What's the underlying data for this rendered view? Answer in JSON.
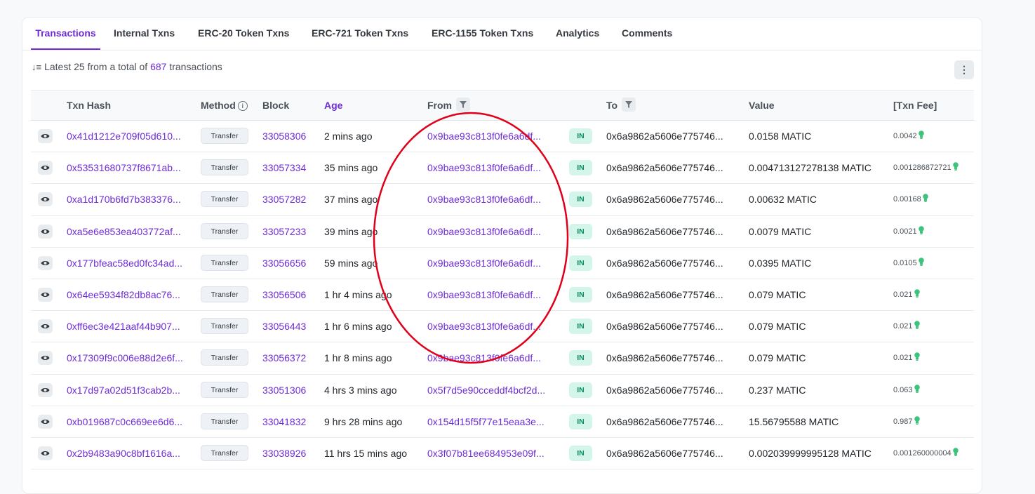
{
  "tabs": [
    {
      "label": "Transactions",
      "active": true
    },
    {
      "label": "Internal Txns",
      "active": false
    },
    {
      "label": "ERC-20 Token Txns",
      "active": false
    },
    {
      "label": "ERC-721 Token Txns",
      "active": false
    },
    {
      "label": "ERC-1155 Token Txns",
      "active": false
    },
    {
      "label": "Analytics",
      "active": false
    },
    {
      "label": "Comments",
      "active": false
    }
  ],
  "summary": {
    "prefix": "Latest 25 from a total of",
    "count": "687",
    "suffix": "transactions",
    "sort_icon": "sort-descending-icon"
  },
  "more_button": {
    "glyph": "⋮",
    "icon": "more-vertical-icon"
  },
  "columns": {
    "hash": "Txn Hash",
    "method": "Method",
    "block": "Block",
    "age": "Age",
    "from": "From",
    "to": "To",
    "value": "Value",
    "fee": "[Txn Fee]"
  },
  "rows": [
    {
      "hash": "0x41d1212e709f05d610...",
      "method": "Transfer",
      "block": "33058306",
      "age": "2 mins ago",
      "from": "0x9bae93c813f0fe6a6df...",
      "dir": "IN",
      "to": "0x6a9862a5606e775746...",
      "value": "0.0158 MATIC",
      "fee": "0.0042"
    },
    {
      "hash": "0x53531680737f8671ab...",
      "method": "Transfer",
      "block": "33057334",
      "age": "35 mins ago",
      "from": "0x9bae93c813f0fe6a6df...",
      "dir": "IN",
      "to": "0x6a9862a5606e775746...",
      "value": "0.004713127278138 MATIC",
      "fee": "0.001286872721"
    },
    {
      "hash": "0xa1d170b6fd7b383376...",
      "method": "Transfer",
      "block": "33057282",
      "age": "37 mins ago",
      "from": "0x9bae93c813f0fe6a6df...",
      "dir": "IN",
      "to": "0x6a9862a5606e775746...",
      "value": "0.00632 MATIC",
      "fee": "0.00168"
    },
    {
      "hash": "0xa5e6e853ea403772af...",
      "method": "Transfer",
      "block": "33057233",
      "age": "39 mins ago",
      "from": "0x9bae93c813f0fe6a6df...",
      "dir": "IN",
      "to": "0x6a9862a5606e775746...",
      "value": "0.0079 MATIC",
      "fee": "0.0021"
    },
    {
      "hash": "0x177bfeac58ed0fc34ad...",
      "method": "Transfer",
      "block": "33056656",
      "age": "59 mins ago",
      "from": "0x9bae93c813f0fe6a6df...",
      "dir": "IN",
      "to": "0x6a9862a5606e775746...",
      "value": "0.0395 MATIC",
      "fee": "0.0105"
    },
    {
      "hash": "0x64ee5934f82db8ac76...",
      "method": "Transfer",
      "block": "33056506",
      "age": "1 hr 4 mins ago",
      "from": "0x9bae93c813f0fe6a6df...",
      "dir": "IN",
      "to": "0x6a9862a5606e775746...",
      "value": "0.079 MATIC",
      "fee": "0.021"
    },
    {
      "hash": "0xff6ec3e421aaf44b907...",
      "method": "Transfer",
      "block": "33056443",
      "age": "1 hr 6 mins ago",
      "from": "0x9bae93c813f0fe6a6df...",
      "dir": "IN",
      "to": "0x6a9862a5606e775746...",
      "value": "0.079 MATIC",
      "fee": "0.021"
    },
    {
      "hash": "0x17309f9c006e88d2e6f...",
      "method": "Transfer",
      "block": "33056372",
      "age": "1 hr 8 mins ago",
      "from": "0x9bae93c813f0fe6a6df...",
      "dir": "IN",
      "to": "0x6a9862a5606e775746...",
      "value": "0.079 MATIC",
      "fee": "0.021"
    },
    {
      "hash": "0x17d97a02d51f3cab2b...",
      "method": "Transfer",
      "block": "33051306",
      "age": "4 hrs 3 mins ago",
      "from": "0x5f7d5e90cceddf4bcf2d...",
      "dir": "IN",
      "to": "0x6a9862a5606e775746...",
      "value": "0.237 MATIC",
      "fee": "0.063"
    },
    {
      "hash": "0xb019687c0c669ee6d6...",
      "method": "Transfer",
      "block": "33041832",
      "age": "9 hrs 28 mins ago",
      "from": "0x154d15f5f77e15eaa3e...",
      "dir": "IN",
      "to": "0x6a9862a5606e775746...",
      "value": "15.56795588 MATIC",
      "fee": "0.987"
    },
    {
      "hash": "0x2b9483a90c8bf1616a...",
      "method": "Transfer",
      "block": "33038926",
      "age": "11 hrs 15 mins ago",
      "from": "0x3f07b81ee684953e09f...",
      "dir": "IN",
      "to": "0x6a9862a5606e775746...",
      "value": "0.002039999995128 MATIC",
      "fee": "0.001260000004"
    }
  ],
  "colors": {
    "accent": "#6f2cd6",
    "in_badge_bg": "#d4f5ea",
    "in_badge_text": "#0b8a64",
    "annotation": "#e0001b"
  }
}
